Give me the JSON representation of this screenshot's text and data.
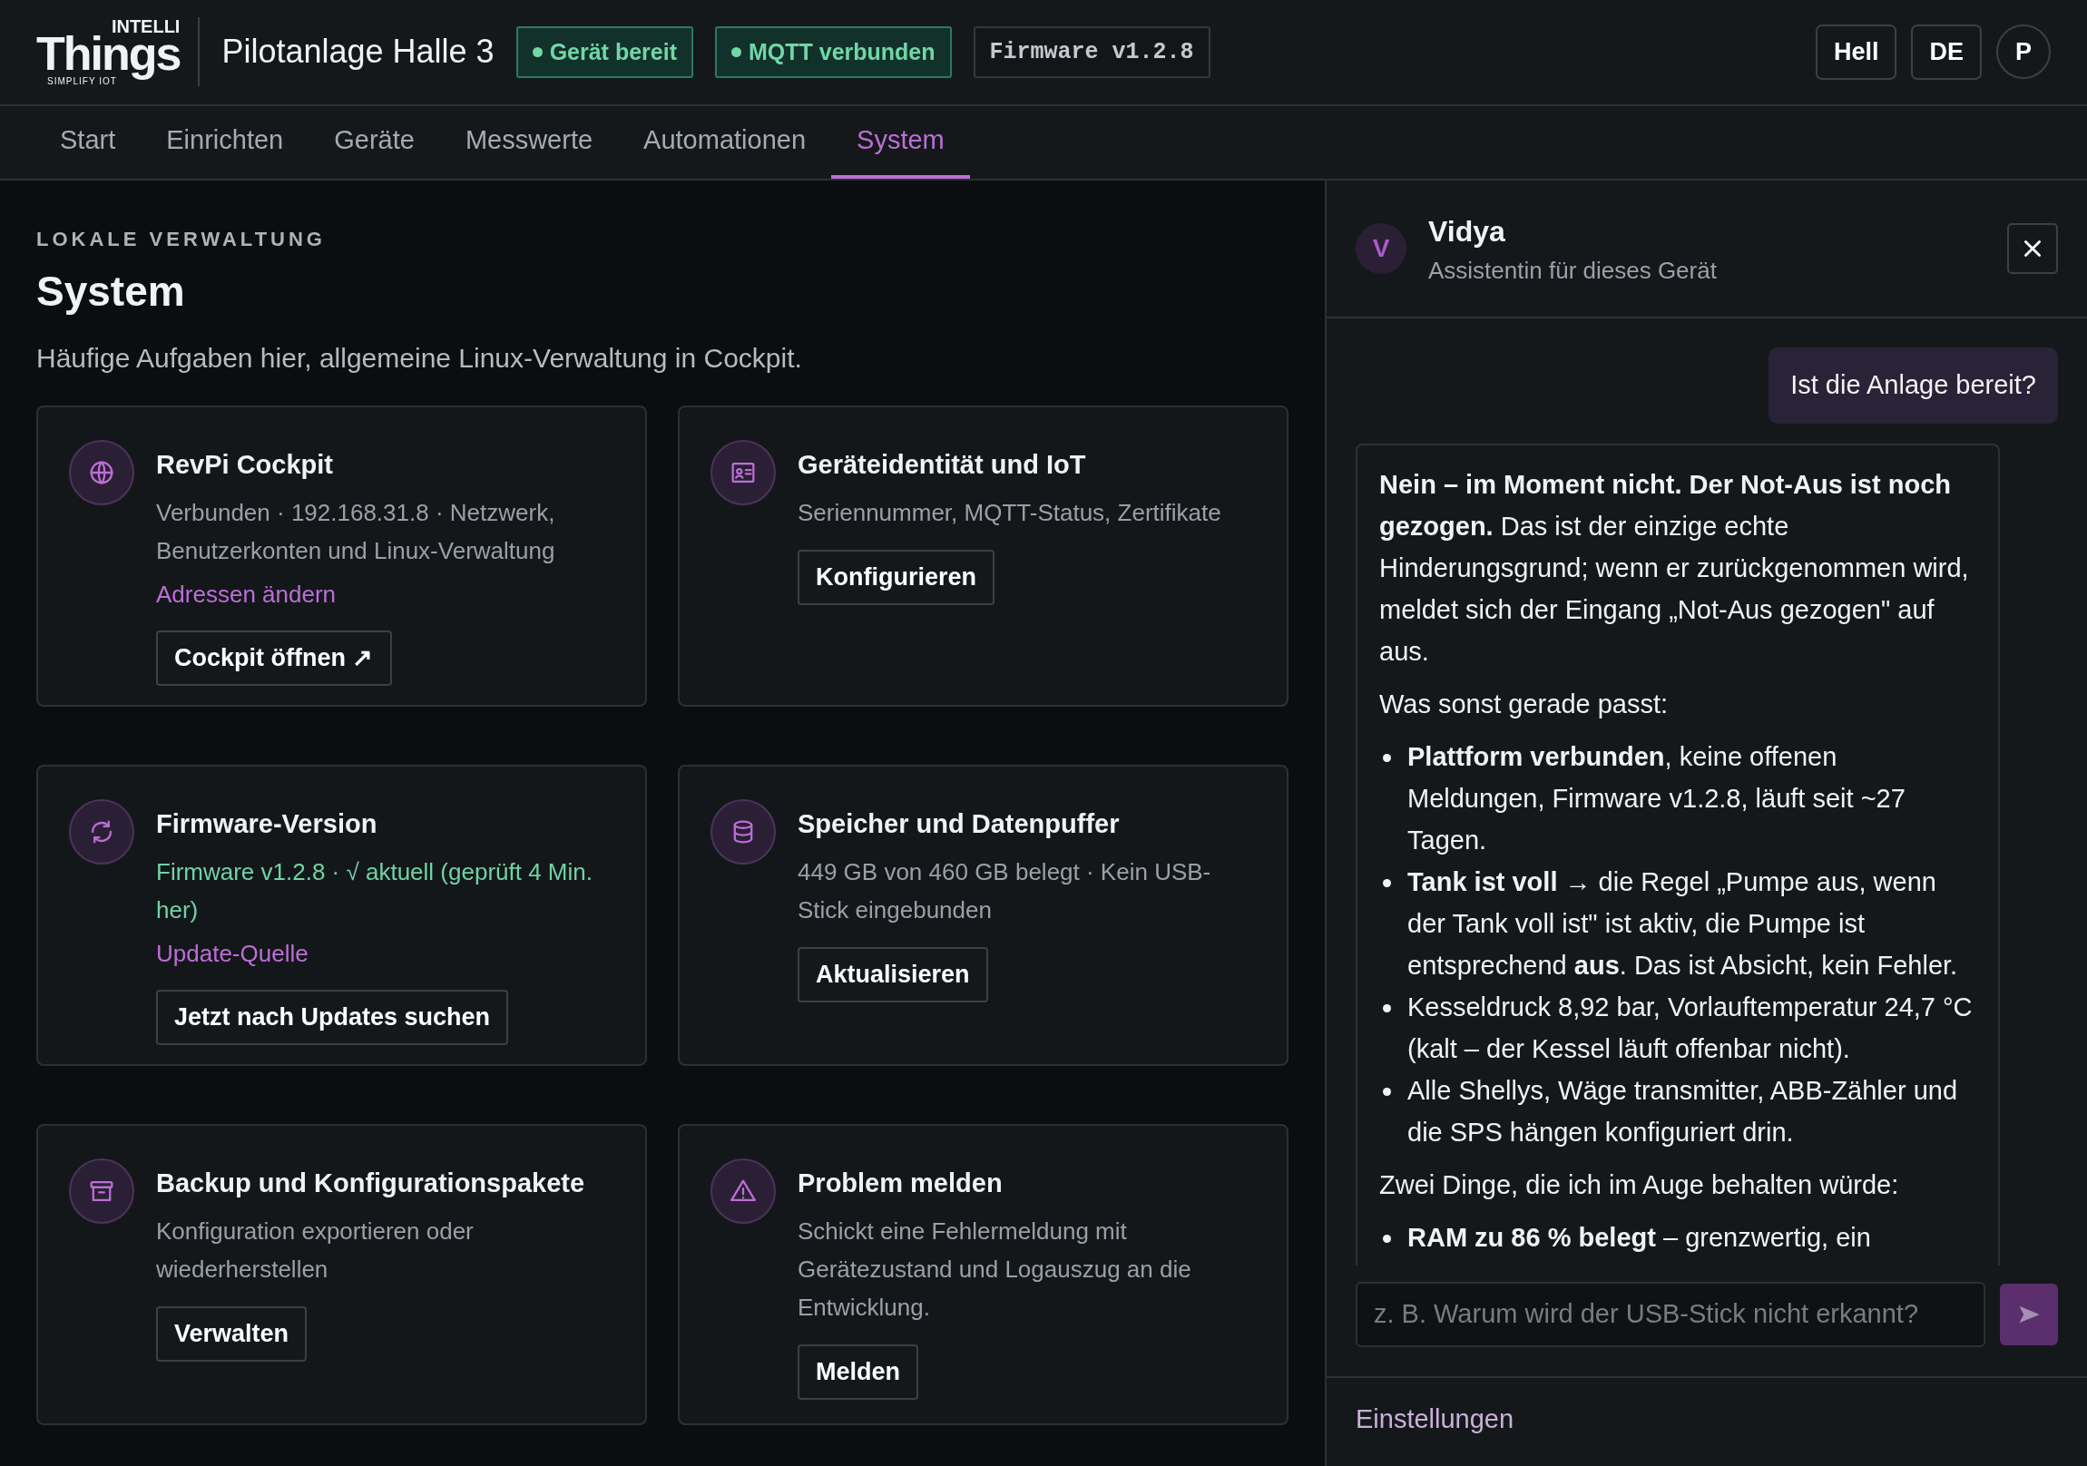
{
  "header": {
    "logo": {
      "top": "INTELLI",
      "main": "Things",
      "tagline": "SIMPLIFY IOT"
    },
    "site_name": "Pilotanlage Halle 3",
    "badges": [
      {
        "label": "Gerät bereit",
        "kind": "status"
      },
      {
        "label": "MQTT verbunden",
        "kind": "status"
      },
      {
        "label": "Firmware v1.2.8",
        "kind": "code"
      }
    ],
    "buttons": [
      "Hell",
      "DE"
    ],
    "avatar": "P"
  },
  "tabs": [
    {
      "label": "Start",
      "selected": false
    },
    {
      "label": "Einrichten",
      "selected": false
    },
    {
      "label": "Geräte",
      "selected": false
    },
    {
      "label": "Messwerte",
      "selected": false
    },
    {
      "label": "Automationen",
      "selected": false
    },
    {
      "label": "System",
      "selected": true
    }
  ],
  "main": {
    "eyebrow": "LOKALE VERWALTUNG",
    "title": "System",
    "subtitle": "Häufige Aufgaben hier, allgemeine Linux-Verwaltung in Cockpit.",
    "cards": [
      {
        "title": "RevPi Cockpit",
        "description": "Verbunden · 192.168.31.8 · Netzwerk, Benutzerkonten und Linux-Verwaltung",
        "kind": "plain",
        "link": "Adressen ändern",
        "button": "Cockpit öffnen ↗"
      },
      {
        "title": "Geräteidentität und IoT",
        "description": "Seriennummer, MQTT-Status, Zertifikate",
        "kind": "plain",
        "button": "Konfigurieren"
      },
      {
        "title": "Firmware-Version",
        "description": "Firmware v1.2.8 · √ aktuell (geprüft 4 Min. her)",
        "kind": "status",
        "link": "Update-Quelle",
        "button": "Jetzt nach Updates suchen"
      },
      {
        "title": "Speicher und Datenpuffer",
        "description": "449 GB von 460 GB belegt · Kein USB-Stick eingebunden",
        "kind": "plain",
        "button": "Aktualisieren"
      },
      {
        "title": "Backup und Konfigurationspakete",
        "description": "Konfiguration exportieren oder wiederherstellen",
        "kind": "plain",
        "button": "Verwalten"
      },
      {
        "title": "Problem melden",
        "description": "Schickt eine Fehlermeldung mit Gerätezustand und Logauszug an die Entwicklung.",
        "kind": "plain",
        "button": "Melden"
      }
    ]
  },
  "assistant": {
    "avatar": "V",
    "name": "Vidya",
    "subtitle": "Assistentin für dieses Gerät",
    "messages": [
      {
        "kind": "user",
        "text": "Ist die Anlage bereit?"
      },
      {
        "kind": "assistant",
        "blocks": [
          {
            "kind": "paragraph",
            "text": "**Nein – im Moment nicht. Der Not-Aus ist noch gezogen.** Das ist der einzige echte Hinderungsgrund; wenn er zurückgenommen wird, meldet sich der Eingang „Not-Aus gezogen\" auf aus."
          },
          {
            "kind": "paragraph",
            "text": "Was sonst gerade passt:"
          },
          {
            "kind": "list",
            "items": [
              "**Plattform verbunden**, keine offenen Meldungen, Firmware v1.2.8, läuft seit ~27 Tagen.",
              "**Tank ist voll** → die Regel „Pumpe aus, wenn der Tank voll ist\" ist aktiv, die Pumpe ist entsprechend **aus**. Das ist Absicht, kein Fehler.",
              "Kesseldruck 8,92 bar, Vorlauftemperatur 24,7 °C (kalt – der Kessel läuft offenbar nicht).",
              "Alle Shellys, Wäge transmitter, ABB-Zähler und die SPS hängen konfiguriert drin."
            ]
          },
          {
            "kind": "paragraph",
            "text": "Zwei Dinge, die ich im Auge behalten würde:"
          },
          {
            "kind": "list",
            "items": [
              "**RAM zu 86 % belegt** – grenzwertig, ein"
            ]
          }
        ]
      }
    ],
    "input": {
      "placeholder": "z. B. Warum wird der USB-Stick nicht erkannt?"
    },
    "footer_link": "Einstellungen"
  }
}
